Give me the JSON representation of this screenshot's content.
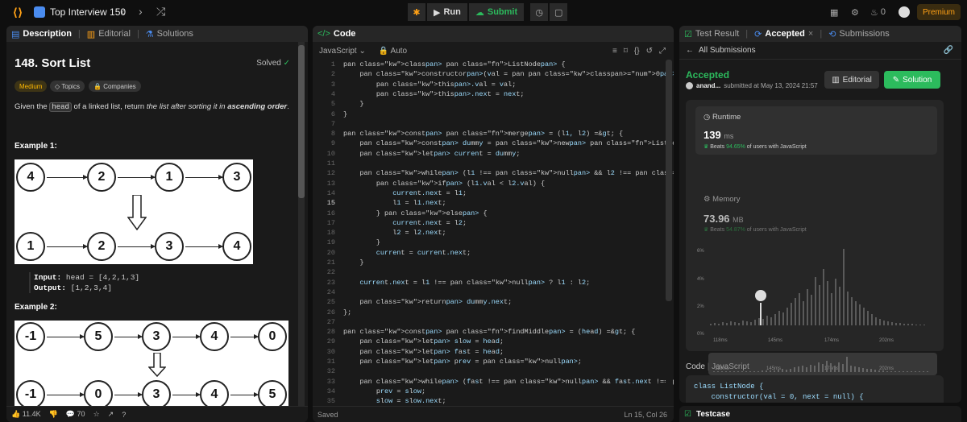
{
  "topbar": {
    "list_title": "Top Interview 150",
    "prev": "‹",
    "next": "›",
    "shuffle": "⤮",
    "run_label": "Run",
    "submit_label": "Submit",
    "streak_count": "0",
    "premium_label": "Premium"
  },
  "left": {
    "tabs": [
      "Description",
      "Editorial",
      "Solutions"
    ],
    "title": "148. Sort List",
    "solved": "Solved",
    "tags": [
      "Medium",
      "Topics",
      "Companies"
    ],
    "desc_pre": "Given the ",
    "desc_code": "head",
    "desc_mid": " of a linked list, return ",
    "desc_em": "the list after sorting it in ",
    "desc_strong": "ascending order",
    "desc_end": ".",
    "example1_label": "Example 1:",
    "example1_input_label": "Input:",
    "example1_input": " head = [4,2,1,3]",
    "example1_output_label": "Output:",
    "example1_output": " [1,2,3,4]",
    "example2_label": "Example 2:",
    "diagram1_top": [
      "4",
      "2",
      "1",
      "3"
    ],
    "diagram1_bottom": [
      "1",
      "2",
      "3",
      "4"
    ],
    "diagram2_top": [
      "-1",
      "5",
      "3",
      "4",
      "0"
    ],
    "diagram2_bottom": [
      "-1",
      "0",
      "3",
      "4",
      "5"
    ],
    "likes": "11.4K",
    "comments": "70"
  },
  "editor": {
    "tab": "Code",
    "language": "JavaScript",
    "mode": "Auto",
    "status": "Saved",
    "cursor": "Ln 15, Col 26",
    "current_line": 15,
    "lines": [
      "class ListNode {",
      "    constructor(val = 0, next = null) {",
      "        this.val = val;",
      "        this.next = next;",
      "    }",
      "}",
      "",
      "const merge = (l1, l2) => {",
      "    const dummy = new ListNode();",
      "    let current = dummy;",
      "",
      "    while (l1 !== null && l2 !== null) {",
      "        if (l1.val < l2.val) {",
      "            current.next = l1;",
      "            l1 = l1.next;",
      "        } else {",
      "            current.next = l2;",
      "            l2 = l2.next;",
      "        }",
      "        current = current.next;",
      "    }",
      "",
      "    current.next = l1 !== null ? l1 : l2;",
      "",
      "    return dummy.next;",
      "};",
      "",
      "const findMiddle = (head) => {",
      "    let slow = head;",
      "    let fast = head;",
      "    let prev = null;",
      "",
      "    while (fast !== null && fast.next !== null) {",
      "        prev = slow;",
      "        slow = slow.next;",
      "        fast = fast.next.next;"
    ]
  },
  "result": {
    "tabs": [
      "Test Result",
      "Accepted",
      "Submissions"
    ],
    "back_label": "All Submissions",
    "status": "Accepted",
    "user": "anand...",
    "submitted": "submitted at May 13, 2024 21:57",
    "editorial_label": "Editorial",
    "solution_label": "Solution",
    "runtime_label": "Runtime",
    "runtime_value": "139",
    "runtime_unit": "ms",
    "runtime_beats_pre": "Beats ",
    "runtime_beats_pct": "94.65%",
    "runtime_beats_post": " of users with JavaScript",
    "memory_label": "Memory",
    "memory_value": "73.96",
    "memory_unit": "MB",
    "memory_beats_pre": "Beats ",
    "memory_beats_pct": "54.87%",
    "memory_beats_post": " of users with JavaScript",
    "y_ticks": [
      "6%",
      "4%",
      "2%",
      "0%"
    ],
    "x_ticks": [
      "118ms",
      "145ms",
      "174ms",
      "202ms"
    ],
    "code_label": "Code",
    "code_lang": "JavaScript",
    "code_line1": "class ListNode {",
    "code_line2": "    constructor(val = 0, next = null) {",
    "testcase_label": "Testcase"
  },
  "colors": {
    "accent": "#ffa116",
    "accepted": "#2cbb5d",
    "background": "#0f0f0f",
    "panel": "#1a1a1a"
  }
}
